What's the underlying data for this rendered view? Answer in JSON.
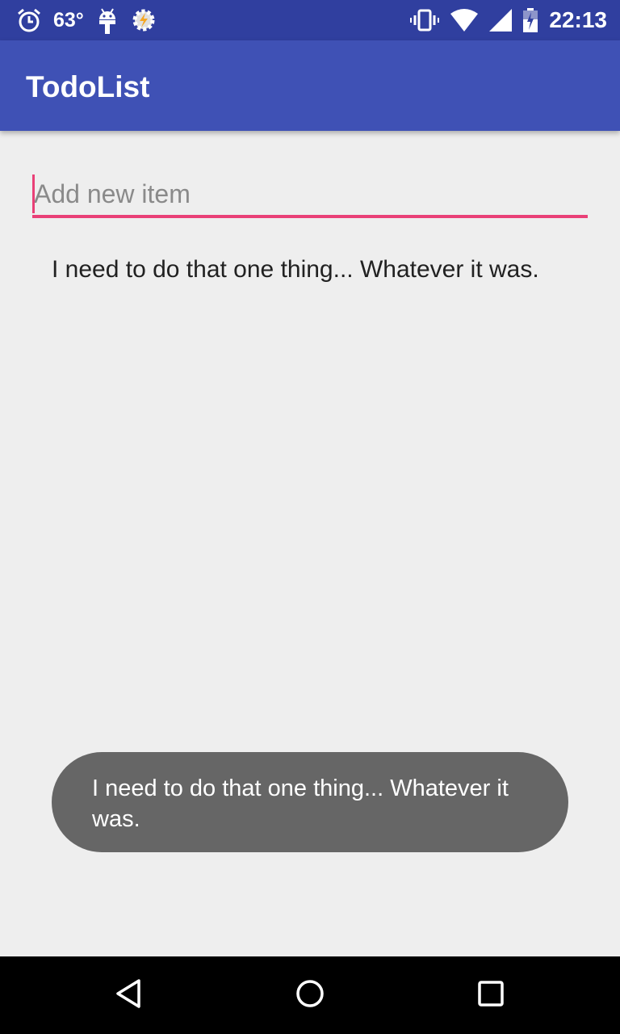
{
  "status_bar": {
    "temperature": "63°",
    "time": "22:13",
    "icons": [
      "alarm-icon",
      "android-debug-icon",
      "tasker-icon",
      "vibrate-icon",
      "wifi-icon",
      "signal-icon",
      "battery-icon"
    ]
  },
  "app_bar": {
    "title": "TodoList"
  },
  "input": {
    "placeholder": "Add new item",
    "value": ""
  },
  "todo_items": [
    {
      "label": "I need to do that one thing... Whatever it was."
    }
  ],
  "toast": {
    "message": "I need to do that one thing... Whatever it was."
  },
  "nav_bar": {
    "icons": [
      "back-icon",
      "home-icon",
      "recents-icon"
    ]
  },
  "colors": {
    "status_bar": "#303f9f",
    "app_bar": "#3f51b5",
    "accent": "#e94077",
    "background": "#eeeeee",
    "toast_bg": "#666666"
  }
}
